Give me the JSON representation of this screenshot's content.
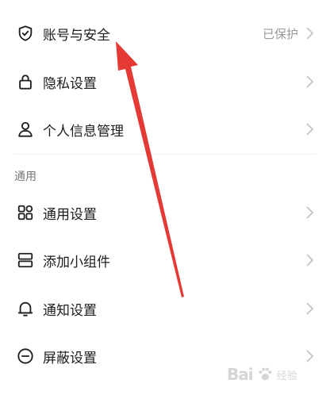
{
  "settings": {
    "items": [
      {
        "label": "账号与安全",
        "value": "已保护",
        "icon": "shield-check-icon"
      },
      {
        "label": "隐私设置",
        "icon": "lock-icon"
      },
      {
        "label": "个人信息管理",
        "icon": "person-icon"
      }
    ]
  },
  "general": {
    "section_title": "通用",
    "items": [
      {
        "label": "通用设置",
        "icon": "grid-icon"
      },
      {
        "label": "添加小组件",
        "icon": "widget-icon"
      },
      {
        "label": "通知设置",
        "icon": "bell-icon"
      },
      {
        "label": "屏蔽设置",
        "icon": "block-icon"
      }
    ]
  },
  "watermark": {
    "text": "Bai",
    "sub": "经验"
  },
  "colors": {
    "annotation_arrow": "#e53935",
    "chevron": "#c4c4c4",
    "text_primary": "#1d1d1d",
    "text_secondary": "#9a9a9a"
  }
}
